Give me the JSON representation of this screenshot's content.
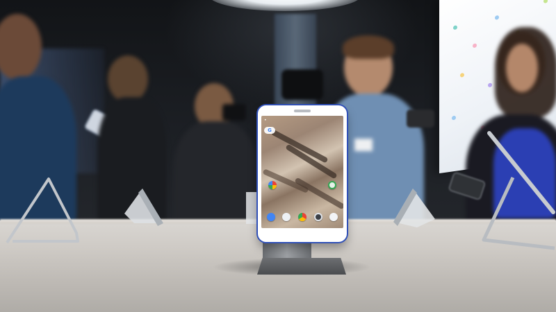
{
  "phone": {
    "status_time": "",
    "lock_clock": "",
    "google_pill_letter": "G",
    "dock_icons": [
      "phone-icon",
      "messages-icon",
      "chrome-icon",
      "camera-icon",
      "gallery-icon"
    ]
  },
  "colors": {
    "phone_accent": "#2f4fb7",
    "table_top": "#d9d6d2",
    "screen_wall": "#eef2f7"
  },
  "wall_dots": [
    "#7fd3c9",
    "#f7b3c8",
    "#9ecbf2",
    "#c5e58f",
    "#f5d37c",
    "#b9a6f0"
  ]
}
